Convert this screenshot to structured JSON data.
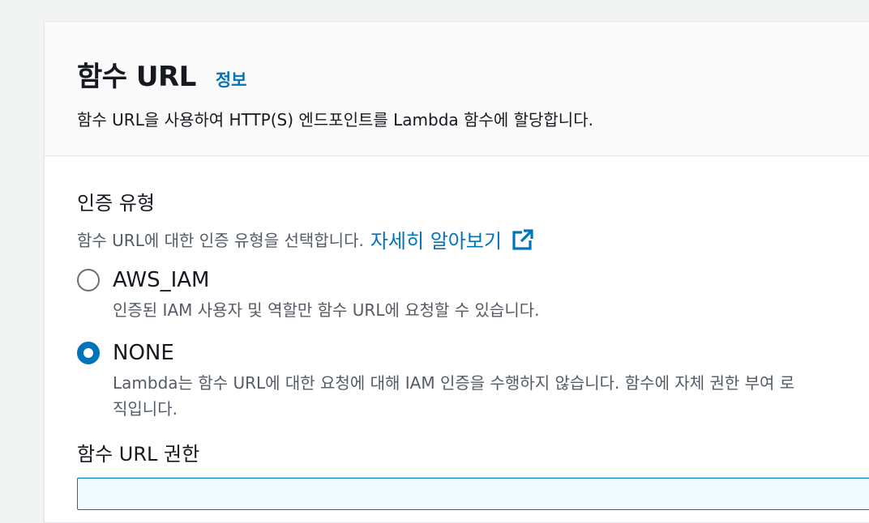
{
  "header": {
    "title": "함수 URL",
    "info_link": "정보",
    "description": "함수 URL을 사용하여 HTTP(S) 엔드포인트를 Lambda 함수에 할당합니다."
  },
  "auth": {
    "title": "인증 유형",
    "description": "함수 URL에 대한 인증 유형을 선택합니다.",
    "learn_more": "자세히 알아보기",
    "options": [
      {
        "label": "AWS_IAM",
        "description": "인증된 IAM 사용자 및 역할만 함수 URL에 요청할 수 있습니다.",
        "selected": false
      },
      {
        "label": "NONE",
        "description": "Lambda는 함수 URL에 대한 요청에 대해 IAM 인증을 수행하지 않습니다. 함수에 자체 권한 부여 로직입니다.",
        "description_line1": "Lambda는 함수 URL에 대한 요청에 대해 IAM 인증을 수행하지 않습니다. 함수에 자체 권한 부여 로",
        "description_line2": "직입니다.",
        "selected": true
      }
    ]
  },
  "permissions": {
    "title": "함수 URL 권한"
  },
  "colors": {
    "link": "#0073bb",
    "radio_selected": "#0073bb",
    "text_primary": "#16191f",
    "text_secondary": "#545b64"
  }
}
